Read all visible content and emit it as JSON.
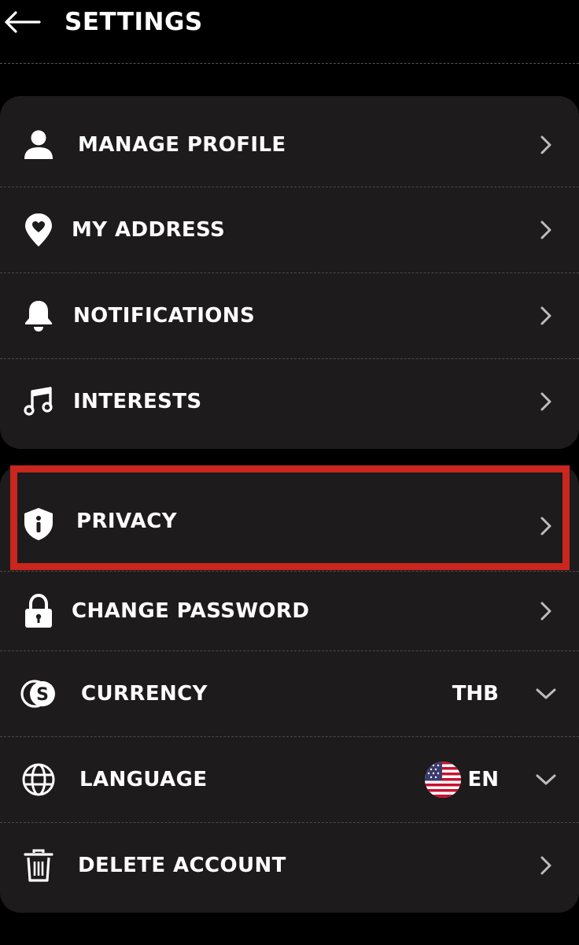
{
  "header": {
    "title": "SETTINGS"
  },
  "colors": {
    "background": "#000000",
    "card": "#1d1b1c",
    "highlight": "#c8261e",
    "text": "#ffffff",
    "chevron": "#bdbdbd"
  },
  "groups": [
    {
      "items": [
        {
          "label": "MANAGE PROFILE",
          "icon": "person-icon"
        },
        {
          "label": "MY ADDRESS",
          "icon": "location-heart-icon"
        },
        {
          "label": "NOTIFICATIONS",
          "icon": "bell-icon"
        },
        {
          "label": "INTERESTS",
          "icon": "music-note-icon"
        }
      ]
    },
    {
      "items": [
        {
          "label": "PRIVACY",
          "icon": "shield-info-icon"
        },
        {
          "label": "CHANGE PASSWORD",
          "icon": "lock-icon"
        },
        {
          "label": "CURRENCY",
          "icon": "currency-icon",
          "value": "THB"
        },
        {
          "label": "LANGUAGE",
          "icon": "globe-icon",
          "value": "EN",
          "flag": "us-flag-icon"
        },
        {
          "label": "DELETE ACCOUNT",
          "icon": "trash-icon"
        }
      ]
    }
  ]
}
